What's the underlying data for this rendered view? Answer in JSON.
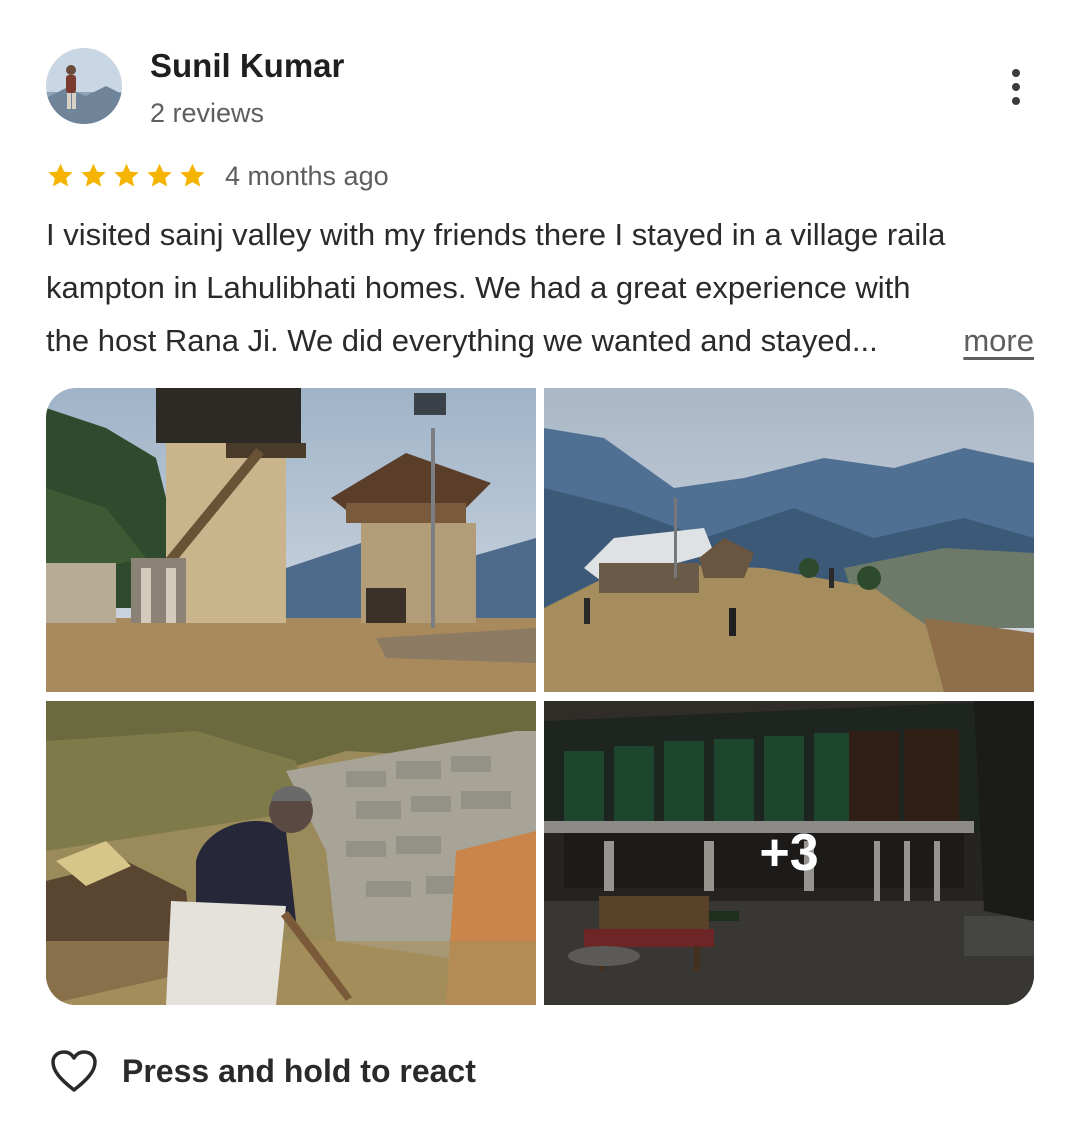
{
  "reviewer": {
    "name": "Sunil Kumar",
    "subtitle": "2 reviews"
  },
  "rating": {
    "stars": 5,
    "max": 5,
    "color": "#f4b400",
    "time": "4 months ago"
  },
  "review": {
    "lines": [
      "I visited sainj valley with my friends there I stayed in a village raila",
      "kampton in Lahulibhati homes. We had a great experience with",
      "the host Rana Ji. We did everything we wanted and stayed..."
    ],
    "more_label": "more"
  },
  "photos": {
    "extra_count_label": "+3"
  },
  "reaction": {
    "label": "Press and hold to react",
    "icon": "heart-outline-icon"
  },
  "menu": {
    "icon": "more-vert-icon"
  }
}
